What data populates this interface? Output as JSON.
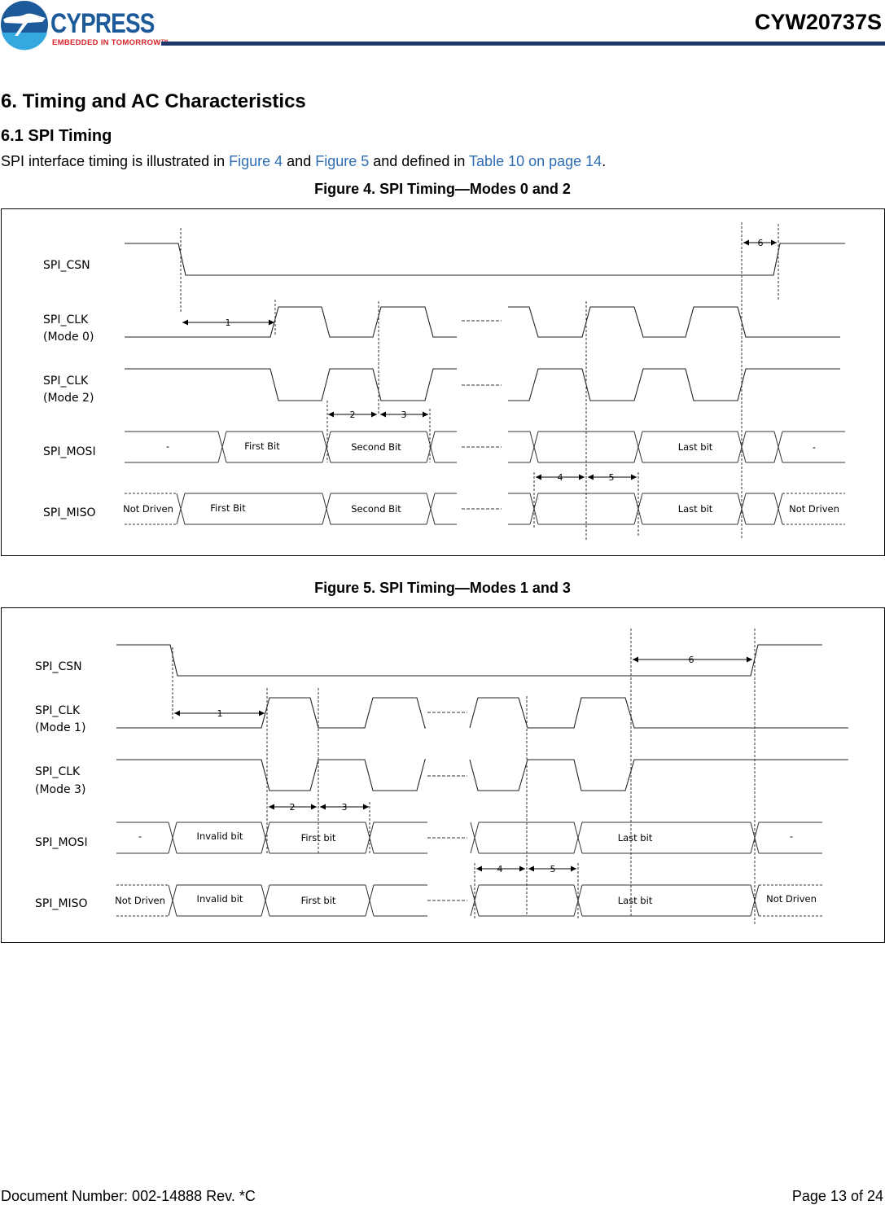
{
  "header": {
    "logo_text": "CYPRESS",
    "logo_tagline": "EMBEDDED IN TOMORROW™",
    "doc_id": "CYW20737S",
    "brand_colors": {
      "blue": "#1d5a9a",
      "red": "#d9252a",
      "rule": "#1b3a6b"
    }
  },
  "section": {
    "title": "6.  Timing and AC Characteristics",
    "subtitle": "6.1  SPI Timing",
    "intro": {
      "t1": "SPI interface timing is illustrated in ",
      "link1": "Figure 4",
      "t2": " and ",
      "link2": "Figure 5",
      "t3": " and defined in ",
      "link3": "Table 10 on page 14",
      "t4": "."
    },
    "link_color": "#2f6db5"
  },
  "figure4": {
    "caption": "Figure 4. SPI Timing—Modes 0 and 2",
    "signals": {
      "csn": "SPI_CSN",
      "clk0": "SPI_CLK",
      "clk0_mode": "(Mode 0)",
      "clk2": "SPI_CLK",
      "clk2_mode": "(Mode 2)",
      "mosi": "SPI_MOSI",
      "miso": "SPI_MISO"
    },
    "mosi_bits": [
      "-",
      "First Bit",
      "Second Bit",
      "Last bit",
      "-"
    ],
    "miso_bits": [
      "Not Driven",
      "First Bit",
      "Second Bit",
      "Last bit",
      "Not Driven"
    ],
    "markers": [
      "1",
      "2",
      "3",
      "4",
      "5",
      "6"
    ]
  },
  "figure5": {
    "caption": "Figure 5. SPI Timing—Modes 1 and 3",
    "signals": {
      "csn": "SPI_CSN",
      "clk1": "SPI_CLK",
      "clk1_mode": "(Mode 1)",
      "clk3": "SPI_CLK",
      "clk3_mode": "(Mode 3)",
      "mosi": "SPI_MOSI",
      "miso": "SPI_MISO"
    },
    "mosi_bits": [
      "-",
      "Invalid bit",
      "First bit",
      "Last bit",
      "-"
    ],
    "miso_bits": [
      "Not Driven",
      "Invalid bit",
      "First bit",
      "Last bit",
      "Not Driven"
    ],
    "markers": [
      "1",
      "2",
      "3",
      "4",
      "5",
      "6"
    ]
  },
  "footer": {
    "doc_number": "Document Number: 002-14888 Rev. *C",
    "page": "Page 13 of 24"
  }
}
